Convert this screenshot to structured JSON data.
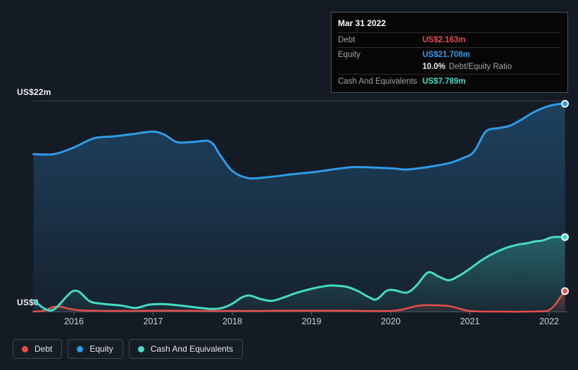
{
  "page": {
    "background": "#151b24"
  },
  "tooltip": {
    "date": "Mar 31 2022",
    "rows": [
      {
        "label": "Debt",
        "value": "US$2.163m"
      },
      {
        "label": "Equity",
        "value": "US$21.708m"
      },
      {
        "label": "Cash And Equivalents",
        "value": "US$7.789m"
      }
    ],
    "ratio_value": "10.0%",
    "ratio_label": "Debt/Equity Ratio"
  },
  "legend": [
    {
      "label": "Debt",
      "color": "#e84d4d"
    },
    {
      "label": "Equity",
      "color": "#2f9be8"
    },
    {
      "label": "Cash And Equivalents",
      "color": "#45dcc3"
    }
  ],
  "chart_data": {
    "type": "area",
    "title": "",
    "xlabel": "",
    "ylabel": "",
    "y_axis": {
      "top_label": "US$22m",
      "bottom_label": "US$0",
      "min": 0,
      "max": 22,
      "unit": "US$m",
      "gridline_values": [
        22,
        20,
        10,
        0
      ]
    },
    "x_ticks": [
      2016,
      2017,
      2018,
      2019,
      2020,
      2021,
      2022
    ],
    "x_range": [
      2015.49,
      2022.2
    ],
    "legend_position": "bottom-left",
    "series": [
      {
        "name": "Equity",
        "color": "#2f9be8",
        "points": [
          [
            2015.49,
            16.45
          ],
          [
            2015.75,
            16.45
          ],
          [
            2016.0,
            17.15
          ],
          [
            2016.25,
            18.1
          ],
          [
            2016.5,
            18.3
          ],
          [
            2016.75,
            18.55
          ],
          [
            2017.0,
            18.8
          ],
          [
            2017.15,
            18.45
          ],
          [
            2017.3,
            17.7
          ],
          [
            2017.5,
            17.72
          ],
          [
            2017.72,
            17.75
          ],
          [
            2017.85,
            16.3
          ],
          [
            2018.0,
            14.7
          ],
          [
            2018.2,
            13.95
          ],
          [
            2018.45,
            14.05
          ],
          [
            2018.75,
            14.35
          ],
          [
            2019.05,
            14.6
          ],
          [
            2019.35,
            14.95
          ],
          [
            2019.55,
            15.1
          ],
          [
            2019.8,
            15.05
          ],
          [
            2020.05,
            14.95
          ],
          [
            2020.2,
            14.85
          ],
          [
            2020.5,
            15.15
          ],
          [
            2020.75,
            15.55
          ],
          [
            2020.9,
            16.0
          ],
          [
            2021.05,
            16.7
          ],
          [
            2021.2,
            18.8
          ],
          [
            2021.35,
            19.15
          ],
          [
            2021.5,
            19.4
          ],
          [
            2021.65,
            20.05
          ],
          [
            2021.8,
            20.8
          ],
          [
            2021.95,
            21.35
          ],
          [
            2022.1,
            21.65
          ],
          [
            2022.2,
            21.708
          ]
        ]
      },
      {
        "name": "Cash And Equivalents",
        "color": "#45dcc3",
        "points": [
          [
            2015.49,
            1.2
          ],
          [
            2015.72,
            0.15
          ],
          [
            2016.0,
            2.2
          ],
          [
            2016.2,
            1.1
          ],
          [
            2016.35,
            0.85
          ],
          [
            2016.6,
            0.65
          ],
          [
            2016.78,
            0.4
          ],
          [
            2016.95,
            0.75
          ],
          [
            2017.15,
            0.8
          ],
          [
            2017.4,
            0.6
          ],
          [
            2017.6,
            0.4
          ],
          [
            2017.75,
            0.3
          ],
          [
            2017.88,
            0.42
          ],
          [
            2018.0,
            0.85
          ],
          [
            2018.12,
            1.5
          ],
          [
            2018.22,
            1.7
          ],
          [
            2018.35,
            1.35
          ],
          [
            2018.5,
            1.15
          ],
          [
            2018.65,
            1.5
          ],
          [
            2018.8,
            1.95
          ],
          [
            2019.0,
            2.4
          ],
          [
            2019.15,
            2.65
          ],
          [
            2019.25,
            2.75
          ],
          [
            2019.45,
            2.6
          ],
          [
            2019.6,
            2.1
          ],
          [
            2019.72,
            1.55
          ],
          [
            2019.82,
            1.3
          ],
          [
            2019.95,
            2.2
          ],
          [
            2020.05,
            2.25
          ],
          [
            2020.2,
            2.0
          ],
          [
            2020.32,
            2.7
          ],
          [
            2020.47,
            4.1
          ],
          [
            2020.6,
            3.7
          ],
          [
            2020.73,
            3.3
          ],
          [
            2020.85,
            3.7
          ],
          [
            2021.0,
            4.5
          ],
          [
            2021.15,
            5.4
          ],
          [
            2021.3,
            6.1
          ],
          [
            2021.45,
            6.65
          ],
          [
            2021.6,
            7.0
          ],
          [
            2021.72,
            7.15
          ],
          [
            2021.82,
            7.35
          ],
          [
            2021.92,
            7.45
          ],
          [
            2022.05,
            7.8
          ],
          [
            2022.2,
            7.789
          ]
        ]
      },
      {
        "name": "Debt",
        "color": "#e84d4d",
        "points": [
          [
            2015.49,
            0.03
          ],
          [
            2015.62,
            0.12
          ],
          [
            2015.73,
            0.48
          ],
          [
            2015.82,
            0.55
          ],
          [
            2015.95,
            0.3
          ],
          [
            2016.1,
            0.15
          ],
          [
            2016.4,
            0.1
          ],
          [
            2016.8,
            0.1
          ],
          [
            2017.2,
            0.12
          ],
          [
            2017.6,
            0.1
          ],
          [
            2018.0,
            0.1
          ],
          [
            2018.4,
            0.1
          ],
          [
            2018.8,
            0.12
          ],
          [
            2019.2,
            0.12
          ],
          [
            2019.6,
            0.1
          ],
          [
            2020.0,
            0.1
          ],
          [
            2020.15,
            0.25
          ],
          [
            2020.32,
            0.6
          ],
          [
            2020.45,
            0.7
          ],
          [
            2020.6,
            0.68
          ],
          [
            2020.75,
            0.58
          ],
          [
            2020.85,
            0.38
          ],
          [
            2020.97,
            0.12
          ],
          [
            2021.1,
            0.04
          ],
          [
            2021.4,
            0.02
          ],
          [
            2021.7,
            0.02
          ],
          [
            2021.95,
            0.08
          ],
          [
            2022.02,
            0.3
          ],
          [
            2022.08,
            0.8
          ],
          [
            2022.14,
            1.5
          ],
          [
            2022.2,
            2.163
          ]
        ]
      }
    ]
  }
}
